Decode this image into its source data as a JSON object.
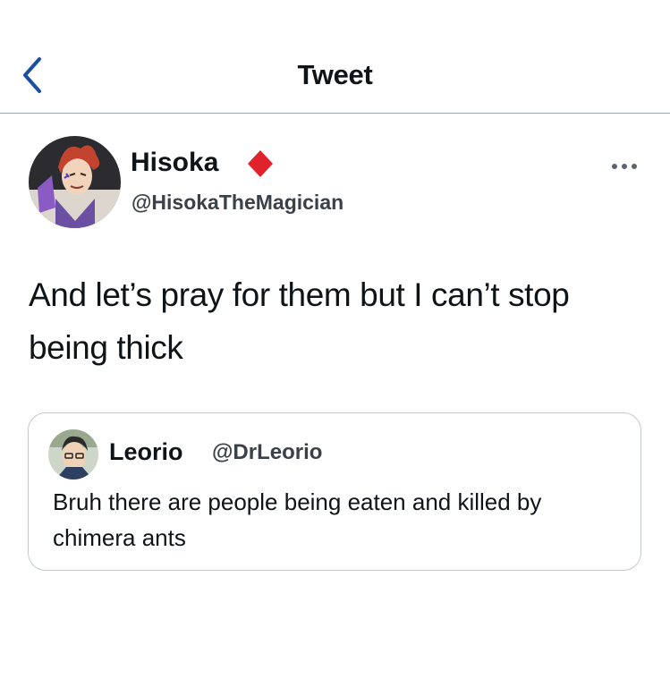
{
  "header": {
    "title": "Tweet",
    "back_icon": "chevron-left-icon"
  },
  "tweet": {
    "author": {
      "display_name": "Hisoka",
      "handle": "@HisokaTheMagician",
      "badge_icon": "red-diamond-icon",
      "avatar_icon": "avatar-image"
    },
    "more_icon": "more-dots-icon",
    "text": "And let’s pray for them but I can’t stop being thick",
    "quoted_tweet": {
      "display_name": "Leorio",
      "handle": "@DrLeorio",
      "text": "Bruh there are people being eaten and killed by chimera ants"
    }
  },
  "colors": {
    "accent": "#1d4fa0",
    "badge": "#e0222a",
    "divider": "#9ca3ab",
    "text": "#0f1419",
    "secondary_text": "#3b4148"
  }
}
